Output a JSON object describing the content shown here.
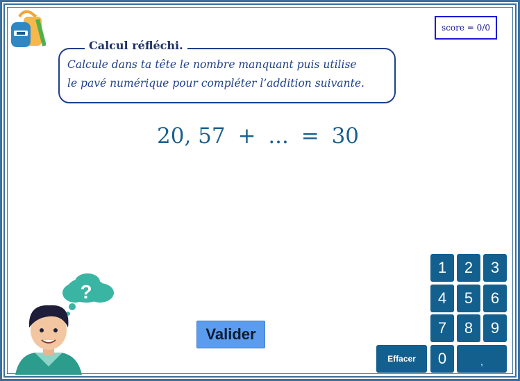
{
  "score": {
    "label": "score = 0/0"
  },
  "instructions": {
    "title": "Calcul réfléchi.",
    "line1": "Calcule dans ta tête le nombre manquant puis utilise",
    "line2": "le pavé numérique pour compléter l’addition suivante."
  },
  "equation": {
    "left": "20, 57",
    "operator": "+",
    "missing": "...",
    "equals": "=",
    "result": "30"
  },
  "actions": {
    "validate_label": "Valider",
    "clear_label": "Effacer"
  },
  "keypad": {
    "row1": [
      "1",
      "2",
      "3"
    ],
    "row2": [
      "4",
      "5",
      "6"
    ],
    "row3": [
      "7",
      "8",
      "9"
    ],
    "zero": "0",
    "comma": ","
  },
  "thought": {
    "symbol": "?"
  },
  "colors": {
    "key_bg": "#13608f",
    "validate_bg": "#5c9cee",
    "frame": "#3a6f9e",
    "text_blue": "#1e3f8a"
  }
}
